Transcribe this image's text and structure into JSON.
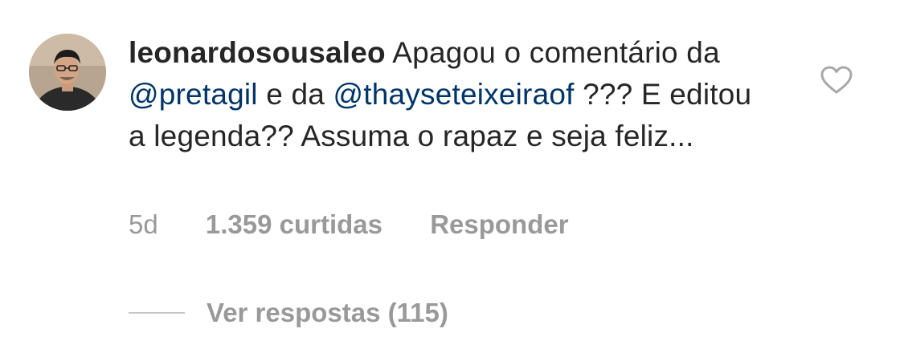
{
  "comment": {
    "username": "leonardosousaleo",
    "text_part1": "Apagou o comentário da ",
    "mention1": "@pretagil",
    "text_part2": " e da ",
    "mention2": "@thayseteixeiraof",
    "text_part3": " ??? E editou a legenda?? Assuma o rapaz e seja feliz...",
    "avatar_icon": "user-avatar-photo",
    "like_icon": "heart-outline-icon"
  },
  "actions": {
    "time": "5d",
    "likes": "1.359 curtidas",
    "reply": "Responder"
  },
  "replies": {
    "label": "Ver respostas (115)"
  },
  "colors": {
    "text": "#262626",
    "mention": "#003569",
    "secondary": "#999999",
    "divider": "#c7c7c7"
  }
}
